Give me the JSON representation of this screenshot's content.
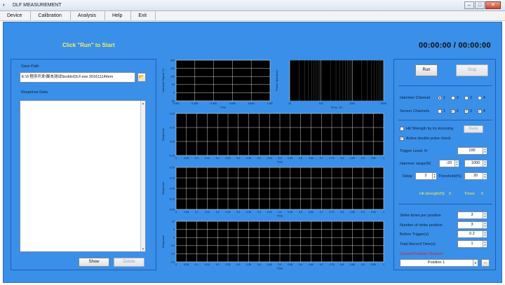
{
  "window": {
    "title": "DLF MEASUREMENT",
    "icon": "◐",
    "min": "–",
    "max": "□",
    "close": "✕"
  },
  "menu": [
    "Device",
    "Calibration",
    "Analysis",
    "Help",
    "Exit"
  ],
  "header": {
    "start_message": "Click \"Run\" to Start",
    "timer": "00:00:00  /  00:00:00"
  },
  "left": {
    "save_path_label": "Save Path",
    "save_path_value": "E:\\0 程序开发\\脚本测试\\builds\\DLF.exe 20161114\\tem",
    "browse_icon": "folder-icon",
    "response_label": "Response Data",
    "show_button": "Show",
    "delete_button": "Delete"
  },
  "chart_data": [
    {
      "type": "line",
      "ylabel": "Hammer Signal / N",
      "xlabel": "Time",
      "x_ticks": [
        "0.000",
        "0.200",
        "0.400",
        "0.600",
        "0.800",
        "1.000"
      ],
      "y_ticks": [
        "200",
        "150",
        "100",
        "50",
        "0",
        "-50"
      ],
      "series": []
    },
    {
      "type": "line",
      "ylabel": "Power Spectrum",
      "xlabel": "Freq., Hz",
      "x_ticks": [
        "10",
        "100",
        "1000",
        "10000"
      ],
      "y_ticks": [],
      "x_scale": "log",
      "series": []
    },
    {
      "type": "line",
      "ylabel": "Response",
      "xlabel": "Time",
      "x_ticks": [
        "0",
        "0.05",
        "0.1",
        "0.15",
        "0.2",
        "0.25",
        "0.3",
        "0.35",
        "0.4",
        "0.45",
        "0.5",
        "0.55",
        "0.6",
        "0.65",
        "0.7",
        "0.75",
        "0.8",
        "0.85",
        "0.9",
        "0.95",
        "1"
      ],
      "y_ticks": [
        "0.20",
        "0.10",
        "0.00",
        "-0.10"
      ],
      "series": []
    },
    {
      "type": "line",
      "ylabel": "Response",
      "xlabel": "Time",
      "x_ticks": [
        "0",
        "0.05",
        "0.1",
        "0.15",
        "0.2",
        "0.25",
        "0.3",
        "0.35",
        "0.4",
        "0.45",
        "0.5",
        "0.55",
        "0.6",
        "0.65",
        "0.7",
        "0.75",
        "0.8",
        "0.85",
        "0.9",
        "0.95",
        "1"
      ],
      "y_ticks": [
        "0.20",
        "0.10",
        "0.00",
        "-0.10",
        "-0.20"
      ],
      "series": []
    },
    {
      "type": "line",
      "ylabel": "Response",
      "xlabel": "Time",
      "x_ticks": [
        "0",
        "0.05",
        "0.1",
        "0.15",
        "0.2",
        "0.25",
        "0.3",
        "0.35",
        "0.4",
        "0.45",
        "0.5",
        "0.55",
        "0.6",
        "0.65",
        "0.7",
        "0.75",
        "0.8",
        "0.85",
        "0.9",
        "0.95",
        "1"
      ],
      "y_ticks": [
        "10",
        "5",
        "0",
        "-0.5",
        "-1.5",
        "-2.5"
      ],
      "series": []
    }
  ],
  "right": {
    "run_button": "Run",
    "stop_button": "Stop",
    "hammer_channel_label": "Hammer Channel",
    "hammer_channels": [
      "1",
      "2",
      "3",
      "4"
    ],
    "hammer_selected": 0,
    "sensor_channels_label": "Sensor Channels",
    "sensor_channels": [
      "1",
      "2",
      "3",
      "4"
    ],
    "sensor_checked": [
      false,
      true,
      true,
      true
    ],
    "hit_strength_label": "Hit Strength by try knocking",
    "redo_button": "Redo",
    "active_check_label": "Active double-pulse check",
    "trigger_level_label": "Trigger Level, N",
    "trigger_level_value": "100",
    "hammer_range_label": "Hammer range(N)",
    "hammer_range_min": "-20",
    "hammer_range_max": "1000",
    "delay_label": "Delay",
    "delay_value": "2",
    "threshold_label": "Threshold(%)",
    "threshold_value": "20",
    "hit_strength_readout_label": "Hit strength(N)",
    "hit_strength_readout_value": "0",
    "times_label": "Times",
    "times_value": "0",
    "strike_times_label": "Strike times per position",
    "strike_times_value": "3",
    "strike_positions_label": "Number of strike position",
    "strike_positions_value": "3",
    "before_trigger_label": "Before Trigger(s)",
    "before_trigger_value": "0.2",
    "total_record_label": "Total Record Time(s)",
    "total_record_value": "1",
    "current_position_label": "Current Position Channel",
    "position_select_value": "Position 1",
    "more_button": "..."
  },
  "colors": {
    "background": "#3a8fe8",
    "plot_bg": "#000000",
    "grid": "#ffffff",
    "accent_yellow": "#f0f060",
    "accent_red": "#d81e1e"
  }
}
